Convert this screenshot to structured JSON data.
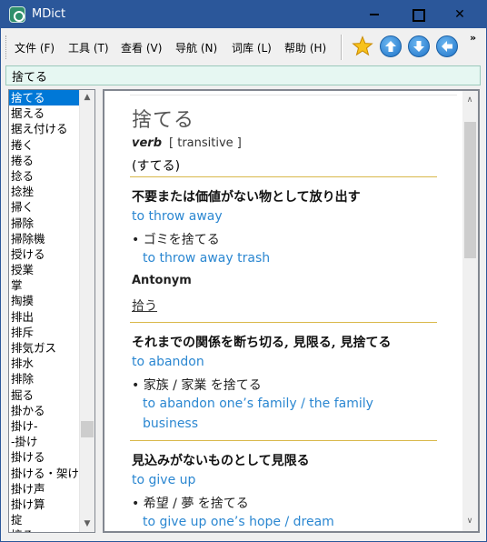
{
  "window": {
    "title": "MDict"
  },
  "menu": [
    {
      "label": "文件 (F)"
    },
    {
      "label": "工具 (T)"
    },
    {
      "label": "查看 (V)"
    },
    {
      "label": "导航 (N)"
    },
    {
      "label": "词库 (L)"
    },
    {
      "label": "帮助 (H)"
    }
  ],
  "toolbar_icons": [
    "star-icon",
    "arrow-up-icon",
    "arrow-down-icon",
    "arrow-left-icon"
  ],
  "search": {
    "value": "捨てる"
  },
  "wordlist": {
    "items": [
      "捨てる",
      "据える",
      "据え付ける",
      "捲く",
      "捲る",
      "捻る",
      "捻挫",
      "掃く",
      "掃除",
      "掃除機",
      "授ける",
      "授業",
      "掌",
      "掏摸",
      "排出",
      "排斥",
      "排気ガス",
      "排水",
      "排除",
      "掘る",
      "掛かる",
      "掛け-",
      "-掛け",
      "掛ける",
      "掛ける・架け",
      "掛け声",
      "掛け算",
      "掟",
      "掠る"
    ],
    "selected_index": 0
  },
  "entry": {
    "headword": "捨てる",
    "pos": "verb",
    "pos_note": "[ transitive ]",
    "reading": "(すてる)",
    "senses": [
      {
        "definition": "不要または価値がない物として放り出す",
        "gloss": "to throw away",
        "example_jp": "• ゴミを捨てる",
        "example_en": "to throw away trash",
        "antonym_label": "Antonym",
        "antonym": "拾う"
      },
      {
        "definition": "それまでの関係を断ち切る, 見限る, 見捨てる",
        "gloss": "to abandon",
        "example_jp": "• 家族 / 家業 を捨てる",
        "example_en": "to abandon one’s family / the family business"
      },
      {
        "definition": "見込みがないものとして見限る",
        "gloss": "to give up",
        "example_jp": "• 希望 / 夢 を捨てる",
        "example_en": "to give up one’s hope / dream"
      }
    ]
  }
}
